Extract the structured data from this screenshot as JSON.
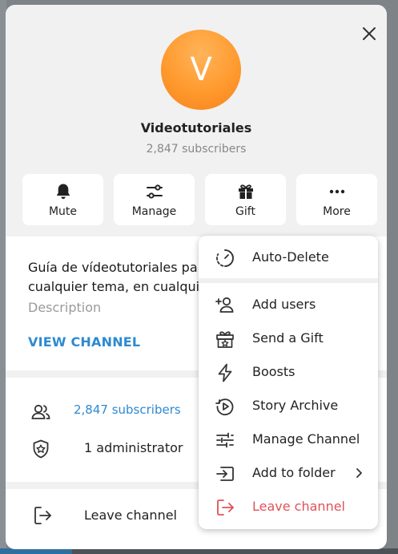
{
  "channel": {
    "avatar_letter": "V",
    "name": "Videotutoriales",
    "subscribers": "2,847 subscribers"
  },
  "actions": {
    "mute": "Mute",
    "manage": "Manage",
    "gift": "Gift",
    "more": "More"
  },
  "info": {
    "description_line1": "Guía de vídeotutoriales para",
    "description_line2": "cualquier tema, en cualquier",
    "description_caption": "Description",
    "view_channel": "VIEW CHANNEL"
  },
  "members": {
    "subscribers_link": "2,847 subscribers",
    "administrators": "1 administrator"
  },
  "leave": "Leave channel",
  "menu": {
    "items": [
      {
        "label": "Auto-Delete",
        "icon": "timer-icon"
      },
      {
        "label": "Add users",
        "icon": "add-user-icon"
      },
      {
        "label": "Send a Gift",
        "icon": "gift-icon"
      },
      {
        "label": "Boosts",
        "icon": "lightning-icon"
      },
      {
        "label": "Story Archive",
        "icon": "story-archive-icon"
      },
      {
        "label": "Manage Channel",
        "icon": "sliders-icon"
      },
      {
        "label": "Add to folder",
        "icon": "folder-add-icon"
      },
      {
        "label": "Leave channel",
        "icon": "leave-icon"
      }
    ]
  },
  "colors": {
    "accent": "#2d8ad1",
    "danger": "#e0525a",
    "avatar": "#ff9a2e"
  }
}
